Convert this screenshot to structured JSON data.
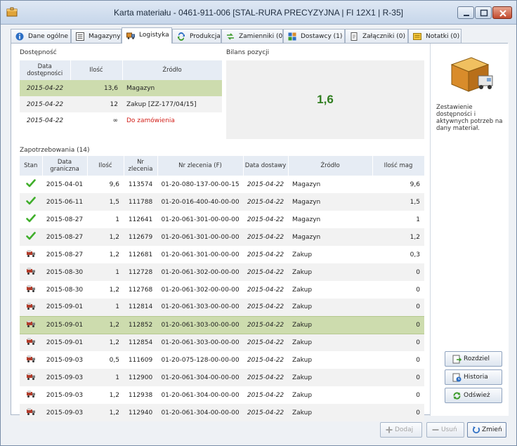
{
  "window": {
    "title": "Karta materiału - 0461-911-006 [STAL-RURA PRECYZYJNA | FI 12X1 | R-35]"
  },
  "tabs": [
    {
      "label": "Dane ogólne",
      "icon": "info-icon"
    },
    {
      "label": "Magazyny",
      "icon": "list-icon"
    },
    {
      "label": "Logistyka",
      "icon": "logistics-icon",
      "active": true
    },
    {
      "label": "Produkcja",
      "icon": "production-icon"
    },
    {
      "label": "Zamienniki (0)",
      "icon": "replace-icon"
    },
    {
      "label": "Dostawcy (1)",
      "icon": "suppliers-icon"
    },
    {
      "label": "Załączniki (0)",
      "icon": "attachment-icon"
    },
    {
      "label": "Notatki (0)",
      "icon": "notes-icon"
    }
  ],
  "availability": {
    "section_label": "Dostępność",
    "headers": {
      "date": "Data dostępności",
      "qty": "Ilość",
      "source": "Źródło"
    },
    "rows": [
      {
        "date": "2015-04-22",
        "qty": "13,6",
        "source": "Magazyn"
      },
      {
        "date": "2015-04-22",
        "qty": "12",
        "source": "Zakup [ZZ-177/04/15]"
      },
      {
        "date": "2015-04-22",
        "qty": "∞",
        "source": "Do zamówienia"
      }
    ]
  },
  "balance": {
    "section_label": "Bilans pozycji",
    "value": "1,6"
  },
  "side": {
    "description": "Zestawienie dostępności i aktywnych potrzeb na dany materiał.",
    "buttons": {
      "split": "Rozdziel",
      "history": "Historia",
      "refresh": "Odśwież"
    }
  },
  "requirements": {
    "section_label": "Zapotrzebowania (14)",
    "headers": {
      "status": "Stan",
      "deadline": "Data graniczna",
      "qty": "Ilość",
      "order_no": "Nr zlecenia",
      "order_no_f": "Nr zlecenia (F)",
      "delivery": "Data dostawy",
      "source": "Źródło",
      "stock_qty": "Ilość mag"
    },
    "rows": [
      {
        "status": "check",
        "deadline": "2015-04-01",
        "qty": "9,6",
        "order": "113574",
        "order_f": "01-20-080-137-00-00-15",
        "delivery": "2015-04-22",
        "source": "Magazyn",
        "stock": "9,6"
      },
      {
        "status": "check",
        "deadline": "2015-06-11",
        "qty": "1,5",
        "order": "111788",
        "order_f": "01-20-016-400-40-00-00",
        "delivery": "2015-04-22",
        "source": "Magazyn",
        "stock": "1,5"
      },
      {
        "status": "check",
        "deadline": "2015-08-27",
        "qty": "1",
        "order": "112641",
        "order_f": "01-20-061-301-00-00-00",
        "delivery": "2015-04-22",
        "source": "Magazyn",
        "stock": "1"
      },
      {
        "status": "check",
        "deadline": "2015-08-27",
        "qty": "1,2",
        "order": "112679",
        "order_f": "01-20-061-301-00-00-00",
        "delivery": "2015-04-22",
        "source": "Magazyn",
        "stock": "1,2"
      },
      {
        "status": "truck",
        "deadline": "2015-08-27",
        "qty": "1,2",
        "order": "112681",
        "order_f": "01-20-061-301-00-00-00",
        "delivery": "2015-04-22",
        "source": "Zakup",
        "stock": "0,3"
      },
      {
        "status": "truck",
        "deadline": "2015-08-30",
        "qty": "1",
        "order": "112728",
        "order_f": "01-20-061-302-00-00-00",
        "delivery": "2015-04-22",
        "source": "Zakup",
        "stock": "0"
      },
      {
        "status": "truck",
        "deadline": "2015-08-30",
        "qty": "1,2",
        "order": "112768",
        "order_f": "01-20-061-302-00-00-00",
        "delivery": "2015-04-22",
        "source": "Zakup",
        "stock": "0"
      },
      {
        "status": "truck",
        "deadline": "2015-09-01",
        "qty": "1",
        "order": "112814",
        "order_f": "01-20-061-303-00-00-00",
        "delivery": "2015-04-22",
        "source": "Zakup",
        "stock": "0"
      },
      {
        "status": "truck",
        "deadline": "2015-09-01",
        "qty": "1,2",
        "order": "112852",
        "order_f": "01-20-061-303-00-00-00",
        "delivery": "2015-04-22",
        "source": "Zakup",
        "stock": "0",
        "selected": true
      },
      {
        "status": "truck",
        "deadline": "2015-09-01",
        "qty": "1,2",
        "order": "112854",
        "order_f": "01-20-061-303-00-00-00",
        "delivery": "2015-04-22",
        "source": "Zakup",
        "stock": "0"
      },
      {
        "status": "truck",
        "deadline": "2015-09-03",
        "qty": "0,5",
        "order": "111609",
        "order_f": "01-20-075-128-00-00-00",
        "delivery": "2015-04-22",
        "source": "Zakup",
        "stock": "0"
      },
      {
        "status": "truck",
        "deadline": "2015-09-03",
        "qty": "1",
        "order": "112900",
        "order_f": "01-20-061-304-00-00-00",
        "delivery": "2015-04-22",
        "source": "Zakup",
        "stock": "0"
      },
      {
        "status": "truck",
        "deadline": "2015-09-03",
        "qty": "1,2",
        "order": "112938",
        "order_f": "01-20-061-304-00-00-00",
        "delivery": "2015-04-22",
        "source": "Zakup",
        "stock": "0"
      },
      {
        "status": "truck",
        "deadline": "2015-09-03",
        "qty": "1,2",
        "order": "112940",
        "order_f": "01-20-061-304-00-00-00",
        "delivery": "2015-04-22",
        "source": "Zakup",
        "stock": "0"
      }
    ]
  },
  "footer": {
    "add": "Dodaj",
    "remove": "Usuń",
    "change": "Zmień"
  },
  "colors": {
    "selected_row": "#cddcae",
    "balance_value": "#2f7d1f",
    "to_order": "#d2201a",
    "check": "#3fae2a"
  }
}
